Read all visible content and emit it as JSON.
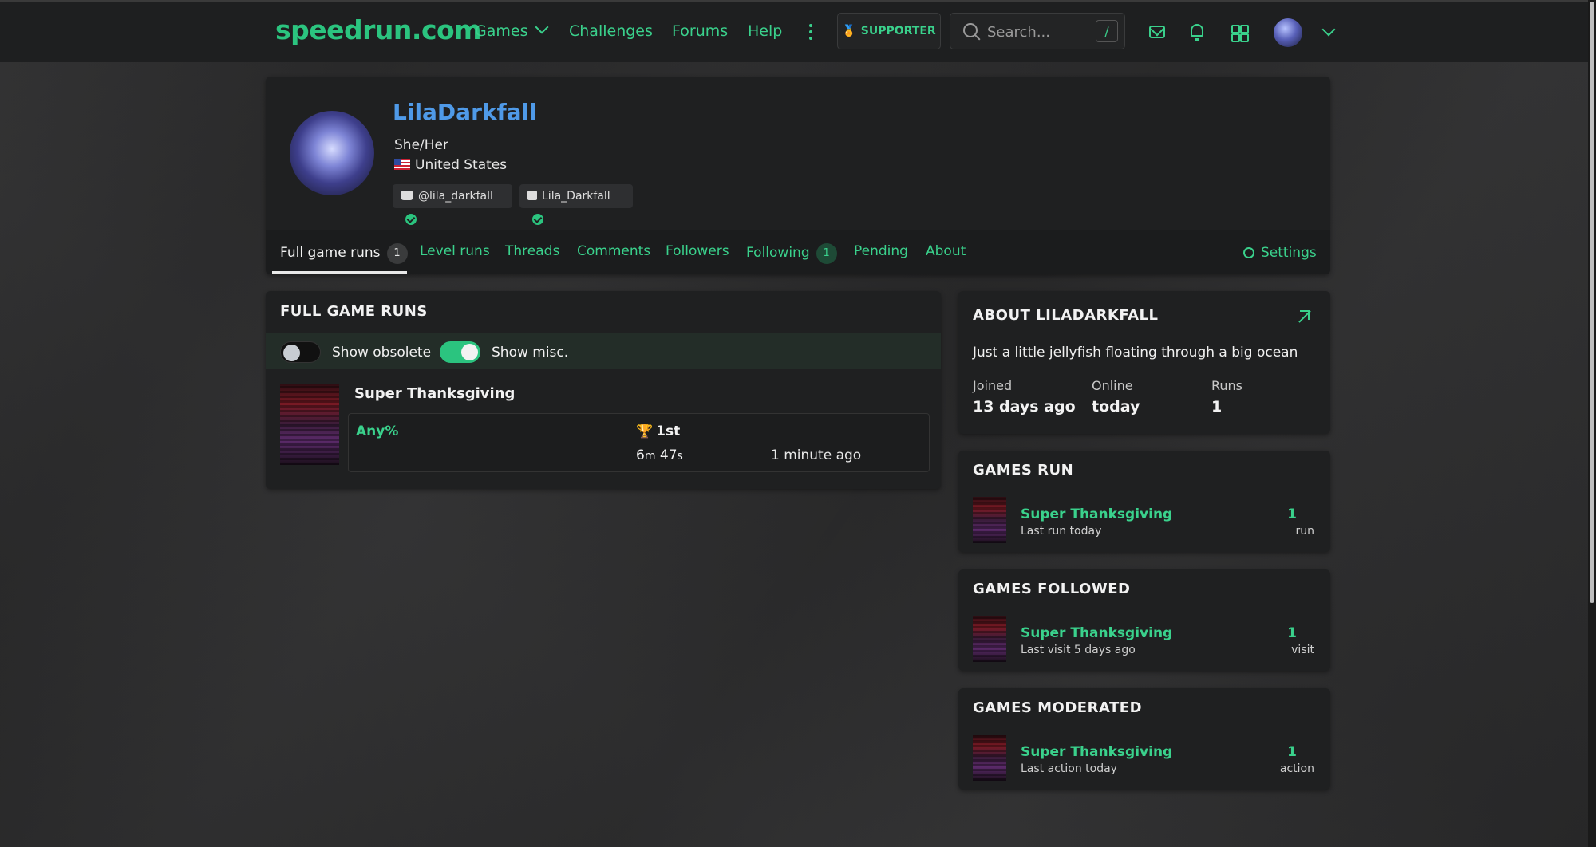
{
  "header": {
    "logo": "speedrun.com",
    "nav": {
      "games": "Games",
      "challenges": "Challenges",
      "forums": "Forums",
      "help": "Help"
    },
    "supporter": "SUPPORTER",
    "search": {
      "placeholder": "Search...",
      "shortcut": "/"
    }
  },
  "profile": {
    "username": "LilaDarkfall",
    "pronouns": "She/Her",
    "country": "United States",
    "socials": {
      "discord": "@lila_darkfall",
      "twitch": "Lila_Darkfall"
    }
  },
  "tabs": {
    "full_game_runs": "Full game runs",
    "full_game_runs_count": "1",
    "level_runs": "Level runs",
    "threads": "Threads",
    "comments": "Comments",
    "followers": "Followers",
    "following": "Following",
    "following_count": "1",
    "pending": "Pending",
    "about": "About",
    "settings": "Settings"
  },
  "runs": {
    "title": "FULL GAME RUNS",
    "show_obsolete": "Show obsolete",
    "show_obsolete_on": false,
    "show_misc": "Show misc.",
    "show_misc_on": true,
    "game": "Super Thanksgiving",
    "category": "Any%",
    "place": "1st",
    "time_m": "6",
    "time_m_unit": "m",
    "time_s": "47",
    "time_s_unit": "s",
    "submitted": "1 minute ago"
  },
  "about": {
    "title": "ABOUT LILADARKFALL",
    "bio": "Just a little jellyfish floating through a big ocean",
    "joined_label": "Joined",
    "joined": "13 days ago",
    "online_label": "Online",
    "online": "today",
    "runs_label": "Runs",
    "runs": "1"
  },
  "games_run": {
    "title": "GAMES RUN",
    "game": "Super Thanksgiving",
    "sub": "Last run today",
    "num": "1",
    "unit": "run"
  },
  "games_followed": {
    "title": "GAMES FOLLOWED",
    "game": "Super Thanksgiving",
    "sub": "Last visit 5 days ago",
    "num": "1",
    "unit": "visit"
  },
  "games_moderated": {
    "title": "GAMES MODERATED",
    "game": "Super Thanksgiving",
    "sub": "Last action today",
    "num": "1",
    "unit": "action"
  },
  "colors": {
    "accent": "#3ad18c",
    "username": "#4f9ae8",
    "card": "#1f2021"
  }
}
